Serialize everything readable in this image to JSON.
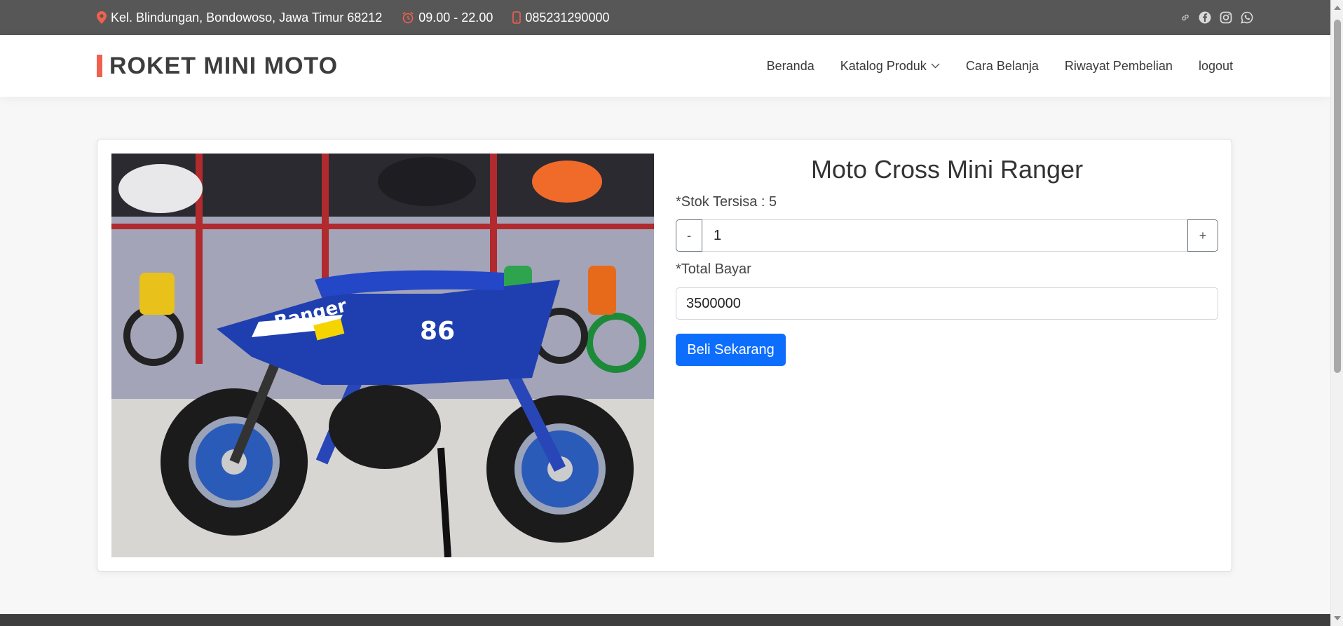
{
  "topbar": {
    "address": "Kel. Blindungan, Bondowoso, Jawa Timur 68212",
    "hours": "09.00 - 22.00",
    "phone": "085231290000",
    "icons": [
      "map-pin-icon",
      "alarm-clock-icon",
      "phone-icon",
      "link-icon",
      "facebook-icon",
      "instagram-icon",
      "whatsapp-icon"
    ],
    "accent_color": "#f0604f",
    "background_color": "#575757"
  },
  "header": {
    "brand": "ROKET MINI MOTO",
    "nav": {
      "home": "Beranda",
      "catalog": "Katalog Produk",
      "how_to_buy": "Cara Belanja",
      "history": "Riwayat Pembelian",
      "logout": "logout"
    }
  },
  "product": {
    "title": "Moto Cross Mini Ranger",
    "stock_label": "*Stok Tersisa : 5",
    "quantity_decrement": "-",
    "quantity_value": "1",
    "quantity_increment": "+",
    "total_label": "*Total Bayar",
    "total_value": "3500000",
    "buy_button": "Beli Sekarang",
    "buy_button_color": "#0d6efd"
  },
  "footer": {
    "background_color": "#3e3e3e"
  }
}
